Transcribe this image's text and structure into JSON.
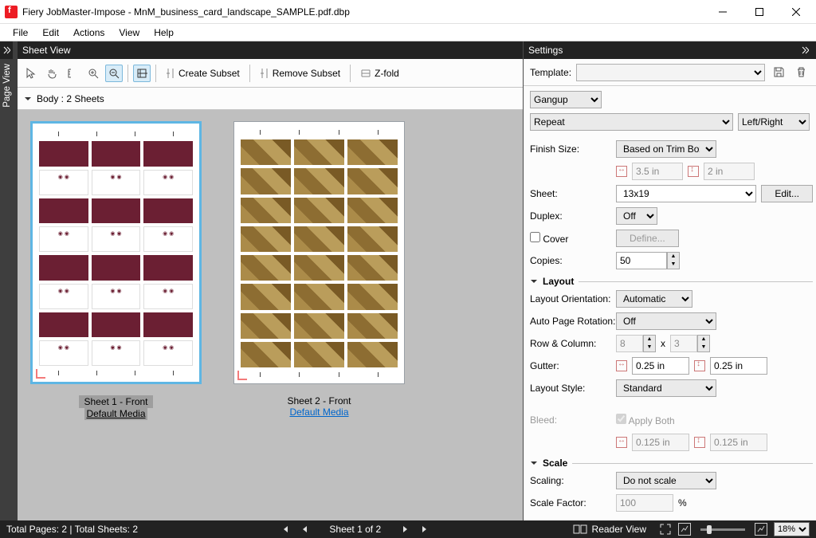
{
  "window": {
    "title": "Fiery JobMaster-Impose - MnM_business_card_landscape_SAMPLE.pdf.dbp"
  },
  "menu": {
    "file": "File",
    "edit": "Edit",
    "actions": "Actions",
    "view": "View",
    "help": "Help"
  },
  "panels": {
    "page_view": "Page View",
    "sheet_view": "Sheet View",
    "settings": "Settings"
  },
  "toolbar": {
    "create_subset": "Create Subset",
    "remove_subset": "Remove Subset",
    "zfold": "Z-fold"
  },
  "body_header": "Body : 2 Sheets",
  "sheets": {
    "one": {
      "label": "Sheet 1 - Front",
      "media": "Default Media"
    },
    "two": {
      "label": "Sheet 2 - Front",
      "media": "Default Media"
    }
  },
  "settings_panel": {
    "template_label": "Template:",
    "mode": "Gangup",
    "style": "Repeat",
    "side": "Left/Right",
    "finish_size": {
      "label": "Finish Size:",
      "value": "Based on Trim Box",
      "w": "3.5 in",
      "h": "2 in"
    },
    "sheet": {
      "label": "Sheet:",
      "value": "13x19",
      "edit": "Edit..."
    },
    "duplex": {
      "label": "Duplex:",
      "value": "Off"
    },
    "cover": {
      "label": "Cover",
      "define": "Define..."
    },
    "copies": {
      "label": "Copies:",
      "value": "50"
    },
    "sections": {
      "layout": "Layout",
      "scale": "Scale"
    },
    "orientation": {
      "label": "Layout Orientation:",
      "value": "Automatic"
    },
    "rotation": {
      "label": "Auto Page Rotation:",
      "value": "Off"
    },
    "rowcol": {
      "label": "Row & Column:",
      "rows": "8",
      "x": "x",
      "cols": "3"
    },
    "gutter": {
      "label": "Gutter:",
      "h": "0.25 in",
      "v": "0.25 in"
    },
    "layout_style": {
      "label": "Layout Style:",
      "value": "Standard"
    },
    "bleed": {
      "label": "Bleed:",
      "apply": "Apply Both",
      "h": "0.125 in",
      "v": "0.125 in"
    },
    "scaling": {
      "label": "Scaling:",
      "value": "Do not scale"
    },
    "scale_factor": {
      "label": "Scale Factor:",
      "value": "100",
      "pct": "%"
    }
  },
  "status": {
    "totals": "Total Pages: 2 | Total Sheets: 2",
    "position": "Sheet 1 of 2",
    "reader_view": "Reader View",
    "zoom": "18%"
  }
}
